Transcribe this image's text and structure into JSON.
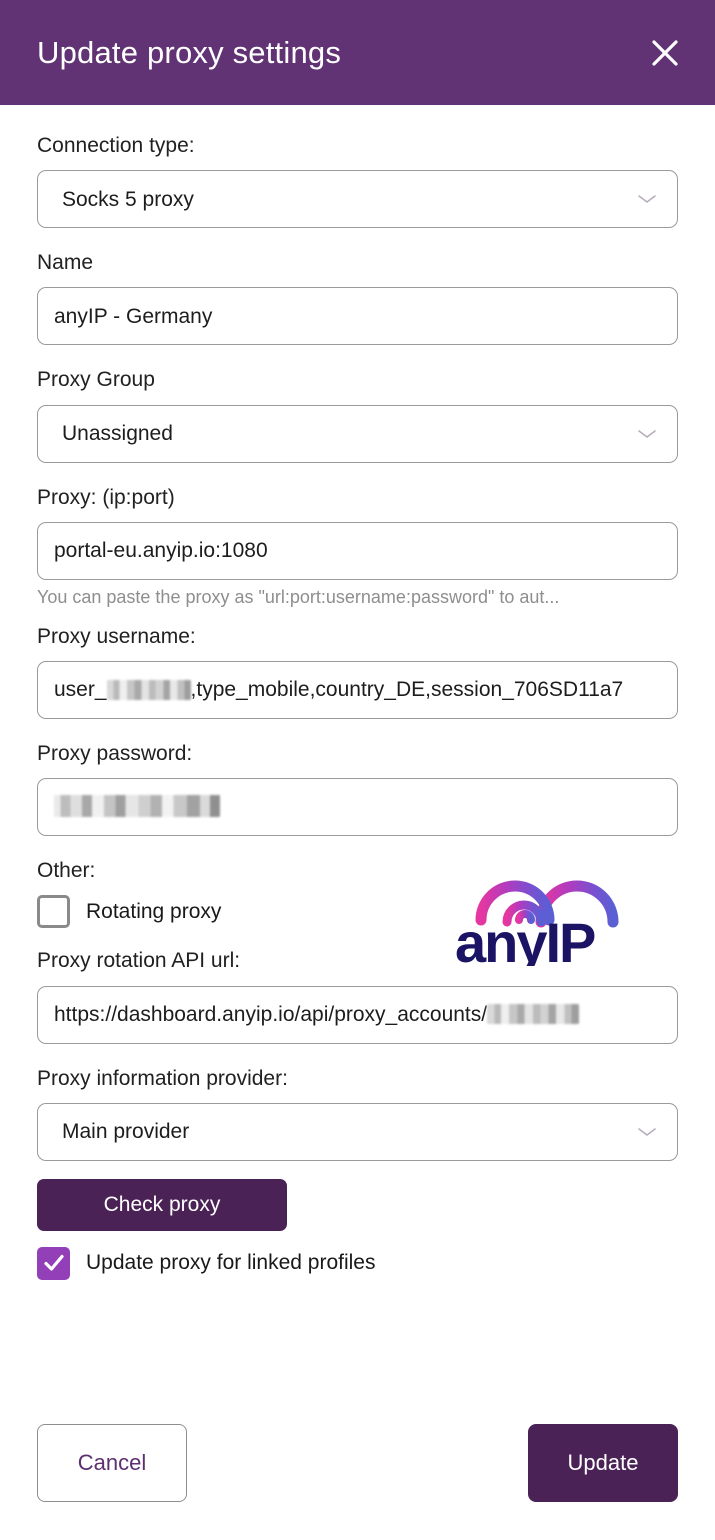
{
  "header": {
    "title": "Update proxy settings",
    "close_icon": "close-icon",
    "background_color": "#613374"
  },
  "form": {
    "connection_type": {
      "label": "Connection type:",
      "value": "Socks 5 proxy",
      "icon": "chevron-down-icon"
    },
    "name": {
      "label": "Name",
      "value": "anyIP - Germany"
    },
    "proxy_group": {
      "label": "Proxy Group",
      "value": "Unassigned",
      "icon": "chevron-down-icon"
    },
    "proxy_address": {
      "label": "Proxy: (ip:port)",
      "value": "portal-eu.anyip.io:1080",
      "helper": "You can paste the proxy as \"url:port:username:password\" to aut..."
    },
    "proxy_username": {
      "label": "Proxy username:",
      "value_prefix": "user_",
      "value_redacted": true,
      "value_suffix": ",type_mobile,country_DE,session_706SD11a7"
    },
    "proxy_password": {
      "label": "Proxy password:",
      "value_redacted": true
    },
    "other": {
      "label": "Other:",
      "rotating_proxy": {
        "label": "Rotating proxy",
        "checked": false
      }
    },
    "rotation_api_url": {
      "label": "Proxy rotation API url:",
      "value_prefix": "https://dashboard.anyip.io/api/proxy_accounts/",
      "value_redacted": true
    },
    "information_provider": {
      "label": "Proxy information provider:",
      "value": "Main provider",
      "icon": "chevron-down-icon"
    },
    "check_proxy": {
      "label": "Check proxy",
      "color": "#4a2256"
    },
    "update_linked": {
      "label": "Update proxy for linked profiles",
      "checked": true,
      "color": "#9340b8"
    }
  },
  "brand": {
    "name": "anyIP",
    "text_color": "#1b1464",
    "arc_colors": [
      "#e5379f",
      "#b13bbf",
      "#7b4fd0",
      "#5a5fd4"
    ]
  },
  "footer": {
    "cancel_label": "Cancel",
    "update_label": "Update",
    "update_color": "#4a2256",
    "cancel_text_color": "#5d2f70"
  }
}
